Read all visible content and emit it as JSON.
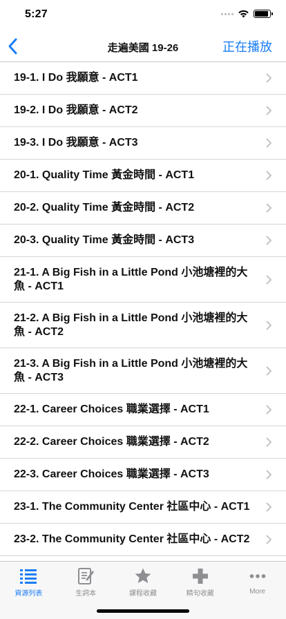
{
  "status_bar": {
    "time": "5:27",
    "battery_level": 0.9
  },
  "nav": {
    "title": "走遍美國 19-26",
    "right_button_label": "正在播放",
    "back_icon": "chevron-left-icon",
    "accent_color": "#1a7df5"
  },
  "lessons": [
    {
      "label": "19-1. I Do 我願意 - ACT1"
    },
    {
      "label": "19-2. I Do 我願意 - ACT2"
    },
    {
      "label": "19-3. I Do 我願意 - ACT3"
    },
    {
      "label": "20-1. Quality Time 黃金時間 - ACT1"
    },
    {
      "label": "20-2. Quality Time 黃金時間 - ACT2"
    },
    {
      "label": "20-3. Quality Time 黃金時間 - ACT3"
    },
    {
      "label": "21-1. A Big Fish in a Little Pond 小池塘裡的大魚 - ACT1"
    },
    {
      "label": "21-2. A Big Fish in a Little Pond 小池塘裡的大魚 - ACT2"
    },
    {
      "label": "21-3. A Big Fish in a Little Pond 小池塘裡的大魚 - ACT3"
    },
    {
      "label": "22-1. Career Choices 職業選擇 - ACT1"
    },
    {
      "label": "22-2. Career Choices 職業選擇 - ACT2"
    },
    {
      "label": "22-3. Career Choices 職業選擇 - ACT3"
    },
    {
      "label": "23-1. The Community Center 社區中心 - ACT1"
    },
    {
      "label": "23-2. The Community Center 社區中心 - ACT2"
    }
  ],
  "tab_bar": {
    "tabs": [
      {
        "label": "資源列表",
        "icon": "list-icon",
        "active": true
      },
      {
        "label": "生詞本",
        "icon": "notebook-icon",
        "active": false
      },
      {
        "label": "課程收藏",
        "icon": "star-icon",
        "active": false
      },
      {
        "label": "精句收藏",
        "icon": "plus-icon",
        "active": false
      },
      {
        "label": "More",
        "icon": "more-icon",
        "active": false
      }
    ]
  }
}
